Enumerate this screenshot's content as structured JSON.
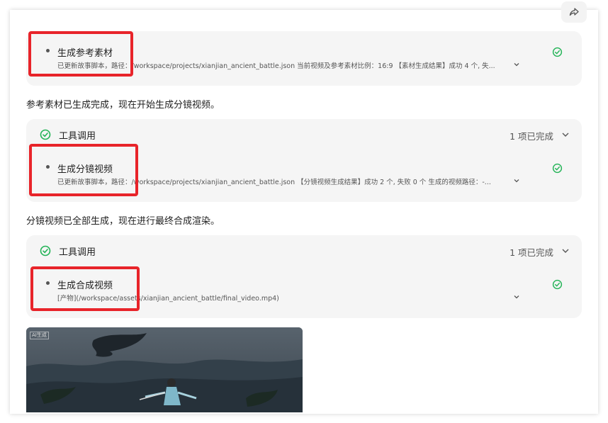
{
  "messages": {
    "m1": "参考素材已生成完成，现在开始生成分镜视频。",
    "m2": "分镜视频已全部生成，现在进行最终合成渲染。"
  },
  "cards": {
    "c1": {
      "item_title": "生成参考素材",
      "item_desc": "已更新故事脚本，路径：/workspace/projects/xianjian_ancient_battle.json 当前视频及参考素材比例：16:9 【素材生成结果】成功 4 个, 失..."
    },
    "c2": {
      "header_title": "工具调用",
      "header_count": "1 项已完成",
      "item_title": "生成分镜视频",
      "item_desc": "已更新故事脚本，路径：/workspace/projects/xianjian_ancient_battle.json 【分镜视频生成结果】成功 2 个, 失败 0 个 生成的视频路径：-..."
    },
    "c3": {
      "header_title": "工具调用",
      "header_count": "1 项已完成",
      "item_title": "生成合成视频",
      "item_desc": "[产物](/workspace/assets/xianjian_ancient_battle/final_video.mp4)"
    }
  },
  "video": {
    "label": "AI生成"
  },
  "colors": {
    "success": "#22b356",
    "highlight": "#e8242a",
    "card_bg": "#f5f5f5"
  },
  "icons": {
    "share": "share-icon",
    "check": "check-circle-icon",
    "chevron": "chevron-down-icon"
  }
}
